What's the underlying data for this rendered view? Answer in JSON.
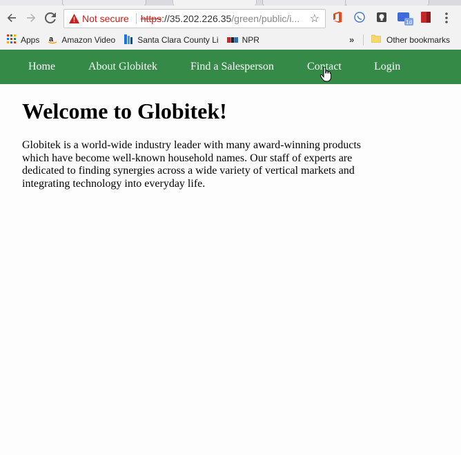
{
  "browser": {
    "security_label": "Not secure",
    "url_scheme": "https",
    "url_host": "://35.202.226.35",
    "url_path": "/green/public/i...",
    "bookmarks": [
      {
        "label": "Apps",
        "icon": "apps-grid-icon"
      },
      {
        "label": "Amazon Video",
        "icon": "amazon-icon"
      },
      {
        "label": "Santa Clara County Li",
        "icon": "library-icon"
      },
      {
        "label": "NPR",
        "icon": "npr-icon"
      }
    ],
    "overflow_label": "»",
    "other_bookmarks": "Other bookmarks"
  },
  "site": {
    "nav": [
      "Home",
      "About Globitek",
      "Find a Salesperson",
      "Contact",
      "Login"
    ],
    "heading": "Welcome to Globitek!",
    "intro": "Globitek is a world-wide industry leader with many award-winning products which have become well-known household names. Our staff of experts are dedicated to finding synergies across a wide variety of vertical markets and integrating technology into everyday life."
  },
  "colors": {
    "nav_bg": "#358a47",
    "insecure": "#c5221f"
  }
}
